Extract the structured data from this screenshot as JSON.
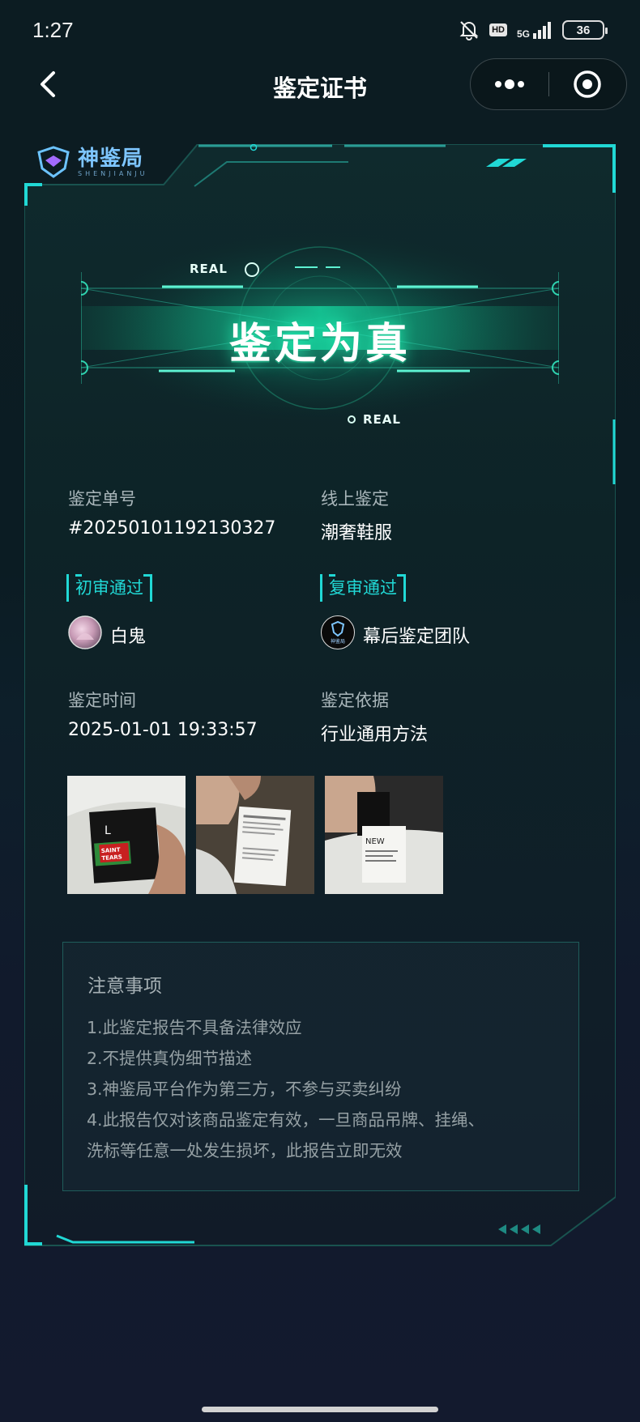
{
  "status_bar": {
    "time": "1:27",
    "hd_badge": "HD",
    "network_label": "5G",
    "battery_level": "36"
  },
  "nav": {
    "title": "鉴定证书"
  },
  "logo": {
    "name": "神鉴局",
    "pinyin": "SHENJIANJU"
  },
  "verdict": {
    "title": "鉴定为真",
    "tag_top": "REAL",
    "tag_bottom": "REAL"
  },
  "info": {
    "order_label": "鉴定单号",
    "order_number": "#20250101192130327",
    "method_label": "线上鉴定",
    "category": "潮奢鞋服",
    "first_review_badge": "初审通过",
    "first_reviewer": "白鬼",
    "second_review_badge": "复审通过",
    "second_reviewer": "幕后鉴定团队",
    "second_reviewer_avatar_text": "神鉴局",
    "time_label": "鉴定时间",
    "time_value": "2025-01-01 19:33:57",
    "basis_label": "鉴定依据",
    "basis_value": "行业通用方法"
  },
  "photos": [
    {
      "tag_size": "L",
      "tag_brand": "SAINT\nTEARS"
    },
    {
      "desc": "wash care label"
    },
    {
      "desc": "neck label"
    }
  ],
  "notes": {
    "title": "注意事项",
    "items": [
      "1.此鉴定报告不具备法律效应",
      "2.不提供真伪细节描述",
      "3.神鉴局平台作为第三方，不参与买卖纠纷",
      "4.此报告仅对该商品鉴定有效，一旦商品吊牌、挂绳、",
      "洗标等任意一处发生损坏，此报告立即无效"
    ]
  },
  "colors": {
    "accent": "#21d8d5",
    "glow": "#28ffbe",
    "background": "#0c1a22"
  }
}
